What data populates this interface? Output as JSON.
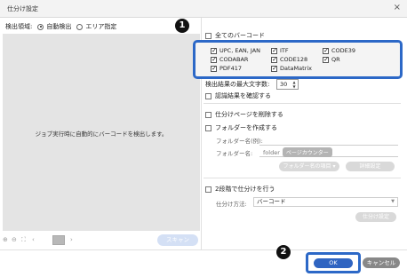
{
  "window": {
    "title": "仕分け設定",
    "close_glyph": "×"
  },
  "detection_area": {
    "label": "検出領域:",
    "options": [
      {
        "label": "自動検出",
        "selected": true
      },
      {
        "label": "エリア指定",
        "selected": false
      }
    ]
  },
  "preview": {
    "message": "ジョブ実行時に自動的にバーコードを検出します。"
  },
  "preview_tools": {
    "zoom_in_icon": "zoom-in-icon",
    "zoom_out_icon": "zoom-out-icon",
    "fit_icon": "fit-icon",
    "prev_icon": "chevron-left-icon",
    "next_icon": "chevron-right-icon",
    "scan_label": "スキャン"
  },
  "barcodes": {
    "all_label": "全てのバーコード",
    "all_checked": false,
    "items": [
      {
        "label": "UPC, EAN, JAN",
        "checked": true
      },
      {
        "label": "CODABAR",
        "checked": true
      },
      {
        "label": "PDF417",
        "checked": true
      },
      {
        "label": "ITF",
        "checked": true
      },
      {
        "label": "CODE128",
        "checked": true
      },
      {
        "label": "DataMatrix",
        "checked": true
      },
      {
        "label": "CODE39",
        "checked": true
      },
      {
        "label": "QR",
        "checked": true
      }
    ]
  },
  "max_chars": {
    "label": "検出結果の最大文字数:",
    "value": "30"
  },
  "confirm_result": {
    "label": "認識結果を確認する",
    "checked": false
  },
  "delete_page": {
    "label": "仕分けページを削除する",
    "checked": false
  },
  "create_folder": {
    "label": "フォルダーを作成する",
    "checked": false,
    "example_label": "フォルダー名(例):",
    "name_label": "フォルダー名:",
    "name_prefix": "folder",
    "name_token": "ページカウンター",
    "items_button": "フォルダー名の項目 ▾",
    "detail_button": "詳細設定"
  },
  "two_step": {
    "label": "2段階で仕分けを行う",
    "checked": false,
    "method_label": "仕分け方法:",
    "method_value": "バーコード",
    "settings_button": "仕分け設定"
  },
  "actions": {
    "ok_label": "OK",
    "cancel_label": "キャンセル"
  },
  "callouts": {
    "one": "1",
    "two": "2"
  },
  "colors": {
    "highlight": "#2c68c7",
    "ok_button": "#2f64c1",
    "cancel_button": "#888888",
    "preview_bg": "#e4e4e4"
  }
}
